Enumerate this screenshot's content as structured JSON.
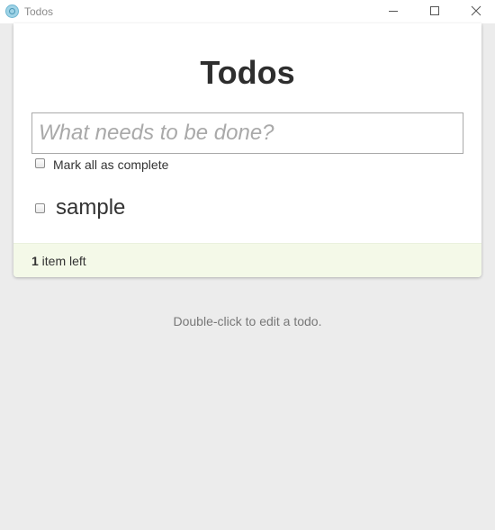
{
  "window": {
    "title": "Todos",
    "app_icon": "electron-app-icon",
    "controls": [
      "minimize-icon",
      "maximize-icon",
      "close-icon"
    ]
  },
  "app": {
    "heading": "Todos",
    "new_todo": {
      "placeholder": "What needs to be done?",
      "value": ""
    },
    "toggle_all_label": "Mark all as complete",
    "todos": [
      {
        "label": "sample",
        "completed": false
      }
    ],
    "footer": {
      "count": "1",
      "count_suffix": " item left"
    },
    "info": "Double-click to edit a todo."
  },
  "colors": {
    "background": "#ececec",
    "card": "#ffffff",
    "footer": "#f4f9e8",
    "heading": "#2e2e2e",
    "placeholder": "#a9a9a9"
  }
}
